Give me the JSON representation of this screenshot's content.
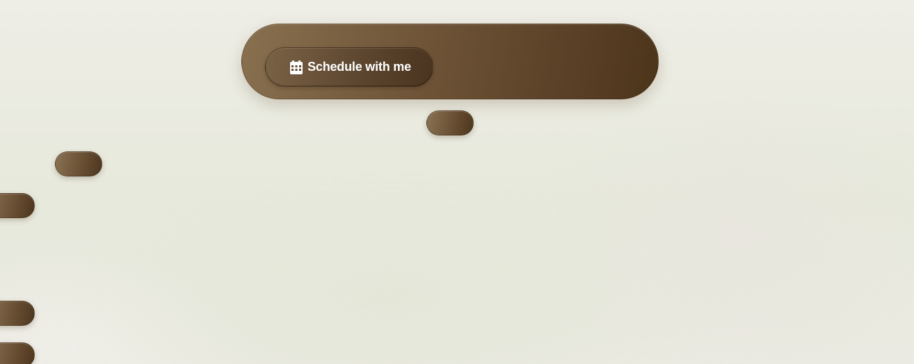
{
  "schedule": {
    "label": "Schedule with me",
    "icon": "calendar-icon"
  },
  "colors": {
    "pill_light": "#88704f",
    "pill_dark": "#4c341b",
    "background": "#eeede6",
    "label_text": "#ffffff"
  }
}
